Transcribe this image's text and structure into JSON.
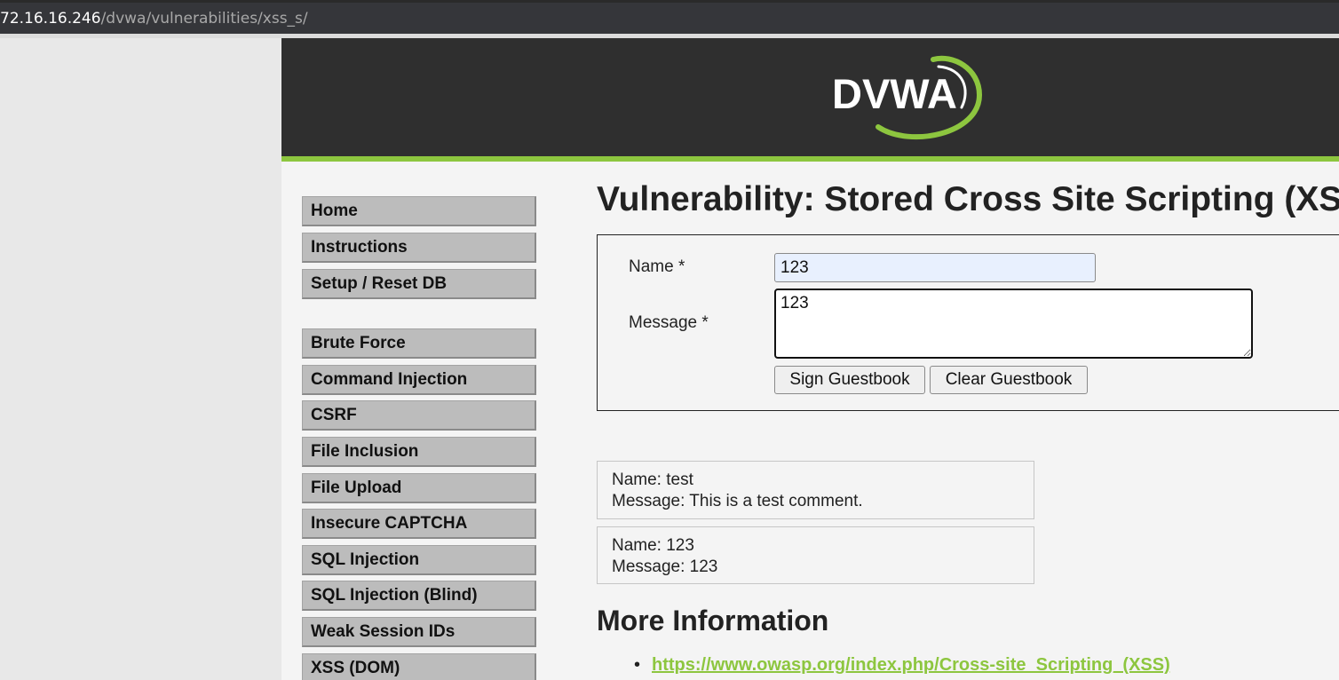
{
  "browser": {
    "address_host": "72.16.16.246",
    "address_path": "/dvwa/vulnerabilities/xss_s/"
  },
  "header": {
    "logo_text": "DVWA",
    "accent_color": "#8dc63f"
  },
  "menu": {
    "group1": [
      "Home",
      "Instructions",
      "Setup / Reset DB"
    ],
    "group2": [
      "Brute Force",
      "Command Injection",
      "CSRF",
      "File Inclusion",
      "File Upload",
      "Insecure CAPTCHA",
      "SQL Injection",
      "SQL Injection (Blind)",
      "Weak Session IDs",
      "XSS (DOM)"
    ]
  },
  "main": {
    "title": "Vulnerability: Stored Cross Site Scripting (XSS)",
    "form": {
      "name_label": "Name *",
      "name_value": "123",
      "message_label": "Message *",
      "message_value": "123",
      "sign_button": "Sign Guestbook",
      "clear_button": "Clear Guestbook"
    },
    "entries": [
      {
        "name": "Name: test",
        "message": "Message: This is a test comment."
      },
      {
        "name": "Name: 123",
        "message": "Message: 123"
      }
    ],
    "more_info_heading": "More Information",
    "links": [
      "https://www.owasp.org/index.php/Cross-site_Scripting_(XSS)"
    ]
  }
}
